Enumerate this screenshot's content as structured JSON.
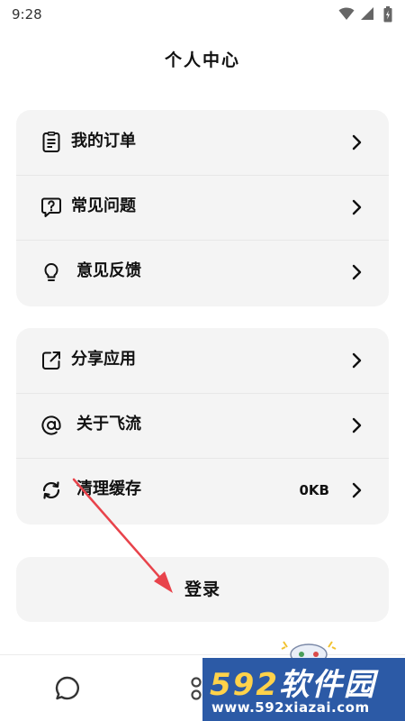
{
  "status_bar": {
    "time": "9:28"
  },
  "header": {
    "title": "个人中心"
  },
  "menu_group_1": [
    {
      "label": "我的订单",
      "icon": "order-list-icon"
    },
    {
      "label": "常见问题",
      "icon": "faq-question-icon"
    },
    {
      "label": "意见反馈",
      "icon": "lightbulb-icon"
    }
  ],
  "menu_group_2": [
    {
      "label": "分享应用",
      "icon": "share-icon"
    },
    {
      "label": "关于飞流",
      "icon": "at-sign-icon"
    },
    {
      "label": "清理缓存",
      "icon": "refresh-icon",
      "value": "0KB"
    }
  ],
  "login": {
    "label": "登录"
  },
  "tab_bar": {
    "tabs": [
      {
        "icon": "chat-icon"
      },
      {
        "icon": "apps-icon"
      }
    ]
  },
  "watermark": {
    "brand_digits": "592",
    "brand_text": "软件园",
    "url": "www.592xiazai.com"
  },
  "colors": {
    "annotation_arrow": "#e8434b",
    "watermark_bg": "#2c5aa6"
  }
}
